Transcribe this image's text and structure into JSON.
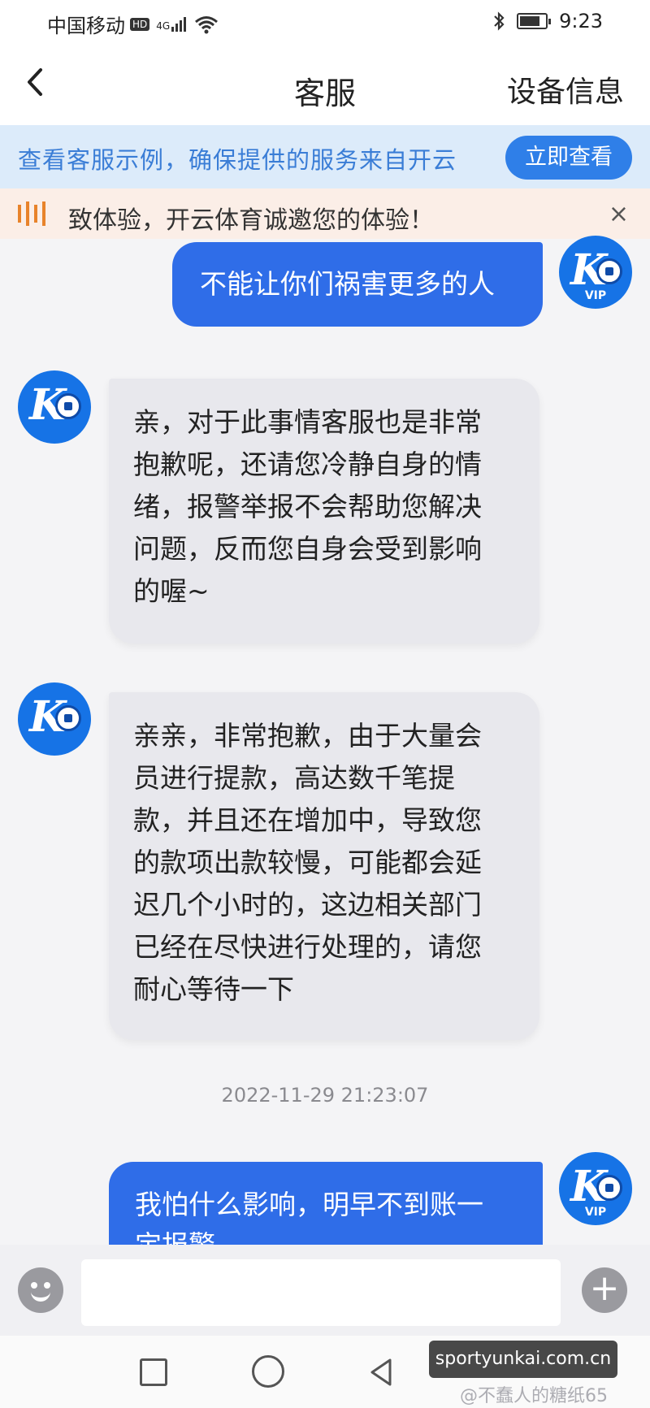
{
  "status_bar": {
    "carrier": "中国移动",
    "hd_badge": "HD",
    "network": "4G",
    "time": "9:23"
  },
  "header": {
    "title": "客服",
    "right_action": "设备信息"
  },
  "notice": {
    "text": "查看客服示例，确保提供的服务来自开云",
    "button_label": "立即查看"
  },
  "marquee": {
    "text": "致体验，开云体育诚邀您的体验！",
    "close_glyph": "×"
  },
  "avatars": {
    "brand_letter": "K",
    "vip_label": "VIP"
  },
  "messages": [
    {
      "from": "user",
      "text": "不能让你们祸害更多的人"
    },
    {
      "from": "agent",
      "lines": [
        "亲，对于此事情客服也是非常",
        "抱歉呢，还请您冷静自身的情",
        "绪，报警举报不会帮助您解决",
        "问题，反而您自身会受到影响",
        "的喔~"
      ]
    },
    {
      "from": "agent",
      "lines": [
        "亲亲，非常抱歉，由于大量会",
        "员进行提款，高达数千笔提",
        "款，并且还在增加中，导致您",
        "的款项出款较慢，可能都会延",
        "迟几个小时的，这边相关部门",
        "已经在尽快进行处理的，请您",
        "耐心等待一下"
      ]
    },
    {
      "from": "user",
      "lines": [
        "我怕什么影响，明早不到账一",
        "定报警"
      ]
    }
  ],
  "timestamp": "2022-11-29 21:23:07",
  "composer": {
    "input_value": "",
    "plus_glyph": "+"
  },
  "watermark": {
    "site": "sportyunkai.com.cn",
    "author": "@不蠢人的糖纸65"
  },
  "colors": {
    "accent": "#2f7fe8",
    "user_bubble": "#2f6de8",
    "agent_bubble": "#e8e8ed",
    "notice_bg": "#dcebfa",
    "marquee_bg": "#fbeee7"
  }
}
